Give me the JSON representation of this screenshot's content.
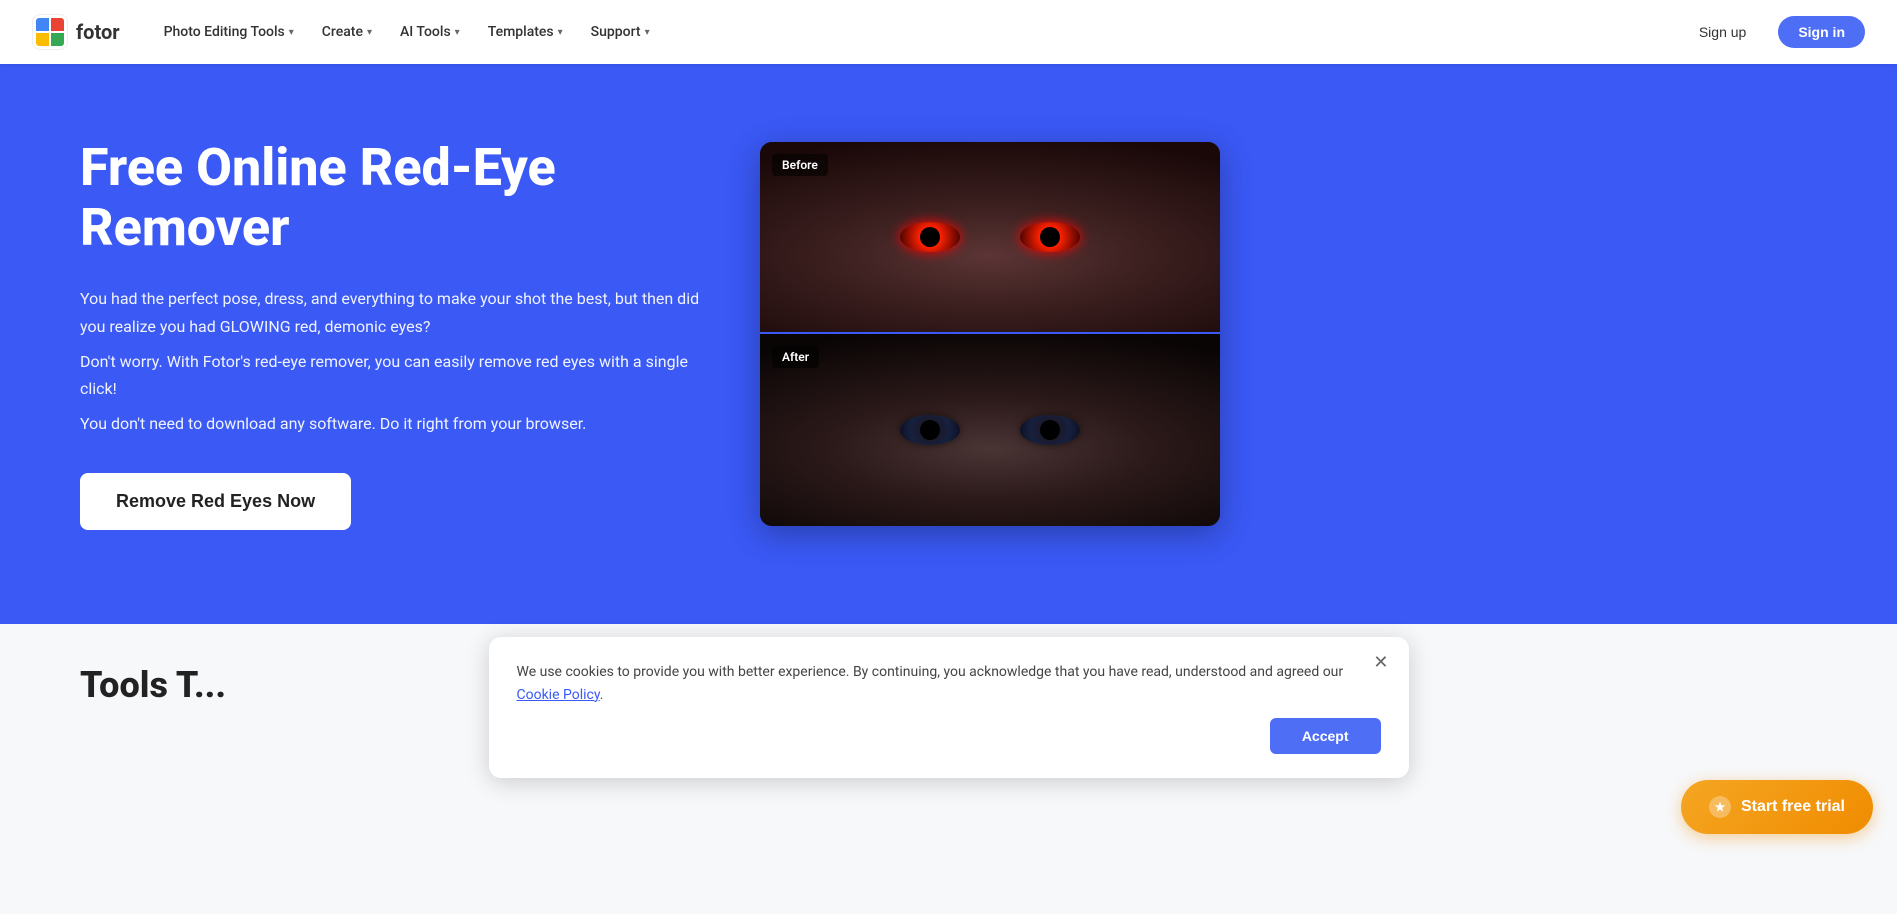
{
  "logo": {
    "text": "fotor"
  },
  "navbar": {
    "items": [
      {
        "label": "Photo Editing Tools",
        "id": "photo-editing-tools"
      },
      {
        "label": "Create",
        "id": "create"
      },
      {
        "label": "AI Tools",
        "id": "ai-tools"
      },
      {
        "label": "Templates",
        "id": "templates"
      },
      {
        "label": "Support",
        "id": "support"
      }
    ],
    "auth": {
      "signup": "Sign up",
      "signin": "Sign in"
    }
  },
  "hero": {
    "title": "Free Online Red-Eye Remover",
    "description_1": "You had the perfect pose, dress, and everything to make your shot the best, but then did you realize you had GLOWING red, demonic eyes?",
    "description_2": "Don't worry. With Fotor's red-eye remover, you can easily remove red eyes with a single click!",
    "description_3": "You don't need to download any software. Do it right from your browser.",
    "cta": "Remove Red Eyes Now",
    "before_label": "Before",
    "after_label": "After"
  },
  "bottom": {
    "partial_title": "Tools T..."
  },
  "cookie": {
    "message": "We use cookies to provide you with better experience. By continuing, you acknowledge that you have read, understood and agreed our",
    "link_text": "Cookie Policy",
    "link_suffix": ".",
    "accept": "Accept"
  },
  "trial": {
    "label": "Start free trial",
    "icon": "★"
  }
}
